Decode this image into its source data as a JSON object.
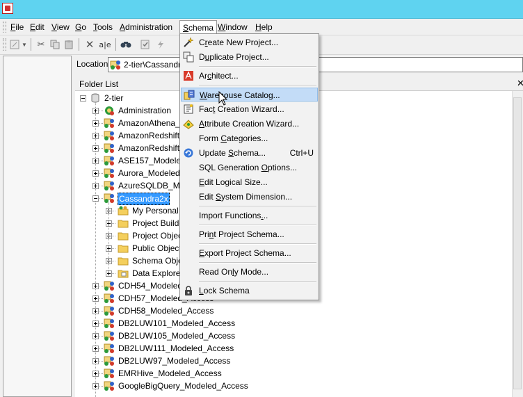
{
  "menubar": {
    "items": [
      {
        "label": "File",
        "underline_index": 0
      },
      {
        "label": "Edit",
        "underline_index": 0
      },
      {
        "label": "View",
        "underline_index": 0
      },
      {
        "label": "Go",
        "underline_index": 0
      },
      {
        "label": "Tools",
        "underline_index": 0
      },
      {
        "label": "Administration",
        "underline_index": 0
      },
      {
        "label": "Schema",
        "underline_index": 0
      },
      {
        "label": "Window",
        "underline_index": 0
      },
      {
        "label": "Help",
        "underline_index": 0
      }
    ]
  },
  "location": {
    "label": "Location:",
    "value": "2-tier\\Cassandra2x"
  },
  "folder_list": {
    "label": "Folder List",
    "close_glyph": "✕"
  },
  "tree": {
    "root": "2-tier",
    "projects_top": [
      {
        "label": "Administration",
        "icon": "administration-icon"
      },
      {
        "label": "AmazonAthena_Modeled_Access",
        "icon": "project-icon"
      },
      {
        "label": "AmazonRedshift_Modeled_Access",
        "icon": "project-icon"
      },
      {
        "label": "AmazonRedshift_ODBC_Modeled",
        "icon": "project-icon"
      },
      {
        "label": "ASE157_Modeled_Access",
        "icon": "project-icon"
      },
      {
        "label": "Aurora_Modeled_Access",
        "icon": "project-icon"
      },
      {
        "label": "AzureSQLDB_Modeled_Access",
        "icon": "project-icon"
      },
      {
        "label": "Cassandra2x",
        "icon": "project-icon",
        "selected": true
      }
    ],
    "children": [
      {
        "label": "My Personal Objects",
        "icon": "personal-folder-icon"
      },
      {
        "label": "Project Builder",
        "icon": "folder-icon"
      },
      {
        "label": "Project Objects",
        "icon": "folder-icon"
      },
      {
        "label": "Public Objects",
        "icon": "folder-icon"
      },
      {
        "label": "Schema Objects",
        "icon": "folder-icon"
      },
      {
        "label": "Data Explorer",
        "icon": "data-explorer-icon"
      }
    ],
    "projects_bottom": [
      {
        "label": "CDH54_Modeled_Access",
        "icon": "project-icon"
      },
      {
        "label": "CDH57_Modeled_Access",
        "icon": "project-icon"
      },
      {
        "label": "CDH58_Modeled_Access",
        "icon": "project-icon"
      },
      {
        "label": "DB2LUW101_Modeled_Access",
        "icon": "project-icon"
      },
      {
        "label": "DB2LUW105_Modeled_Access",
        "icon": "project-icon"
      },
      {
        "label": "DB2LUW111_Modeled_Access",
        "icon": "project-icon"
      },
      {
        "label": "DB2LUW97_Modeled_Access",
        "icon": "project-icon"
      },
      {
        "label": "EMRHive_Modeled_Access",
        "icon": "project-icon"
      },
      {
        "label": "GoogleBigQuery_Modeled_Access",
        "icon": "project-icon"
      }
    ]
  },
  "schema_menu": {
    "items": [
      {
        "label": "Create New Project...",
        "icon": "wand-icon",
        "underline_index": 1
      },
      {
        "label": "Duplicate Project...",
        "icon": "duplicate-icon",
        "underline_index": 1
      },
      {
        "sep": true
      },
      {
        "label": "Architect...",
        "icon": "architect-icon",
        "underline_index": 2
      },
      {
        "sep": true
      },
      {
        "label": "Warehouse Catalog...",
        "icon": "warehouse-catalog-icon",
        "underline_index": 0,
        "highlighted": true
      },
      {
        "label": "Fact Creation Wizard...",
        "icon": "fact-wizard-icon",
        "underline_index": 3
      },
      {
        "label": "Attribute Creation Wizard...",
        "icon": "attribute-wizard-icon",
        "underline_index": 0
      },
      {
        "label": "Form Categories...",
        "icon": "",
        "underline_index": 5
      },
      {
        "label": "Update Schema...",
        "icon": "update-schema-icon",
        "underline_index": 7,
        "shortcut": "Ctrl+U"
      },
      {
        "label": "SQL Generation Options...",
        "icon": "",
        "underline_index": 15
      },
      {
        "label": "Edit Logical Size...",
        "icon": "",
        "underline_index": 0
      },
      {
        "label": "Edit System Dimension...",
        "icon": "",
        "underline_index": 5
      },
      {
        "sep": true
      },
      {
        "label": "Import Functions...",
        "icon": "",
        "underline_index": 16
      },
      {
        "sep": true
      },
      {
        "label": "Print Project Schema...",
        "icon": "",
        "underline_index": 3
      },
      {
        "sep": true
      },
      {
        "label": "Export Project Schema...",
        "icon": "",
        "underline_index": 0
      },
      {
        "sep": true
      },
      {
        "label": "Read Only Mode...",
        "icon": "",
        "underline_index": 7
      },
      {
        "sep": true
      },
      {
        "label": "Lock Schema",
        "icon": "lock-icon",
        "underline_index": 0
      }
    ]
  },
  "colors": {
    "titlebar": "#5fd3f0",
    "selection": "#3399ff",
    "menu_highlight": "#c3dcf7"
  }
}
